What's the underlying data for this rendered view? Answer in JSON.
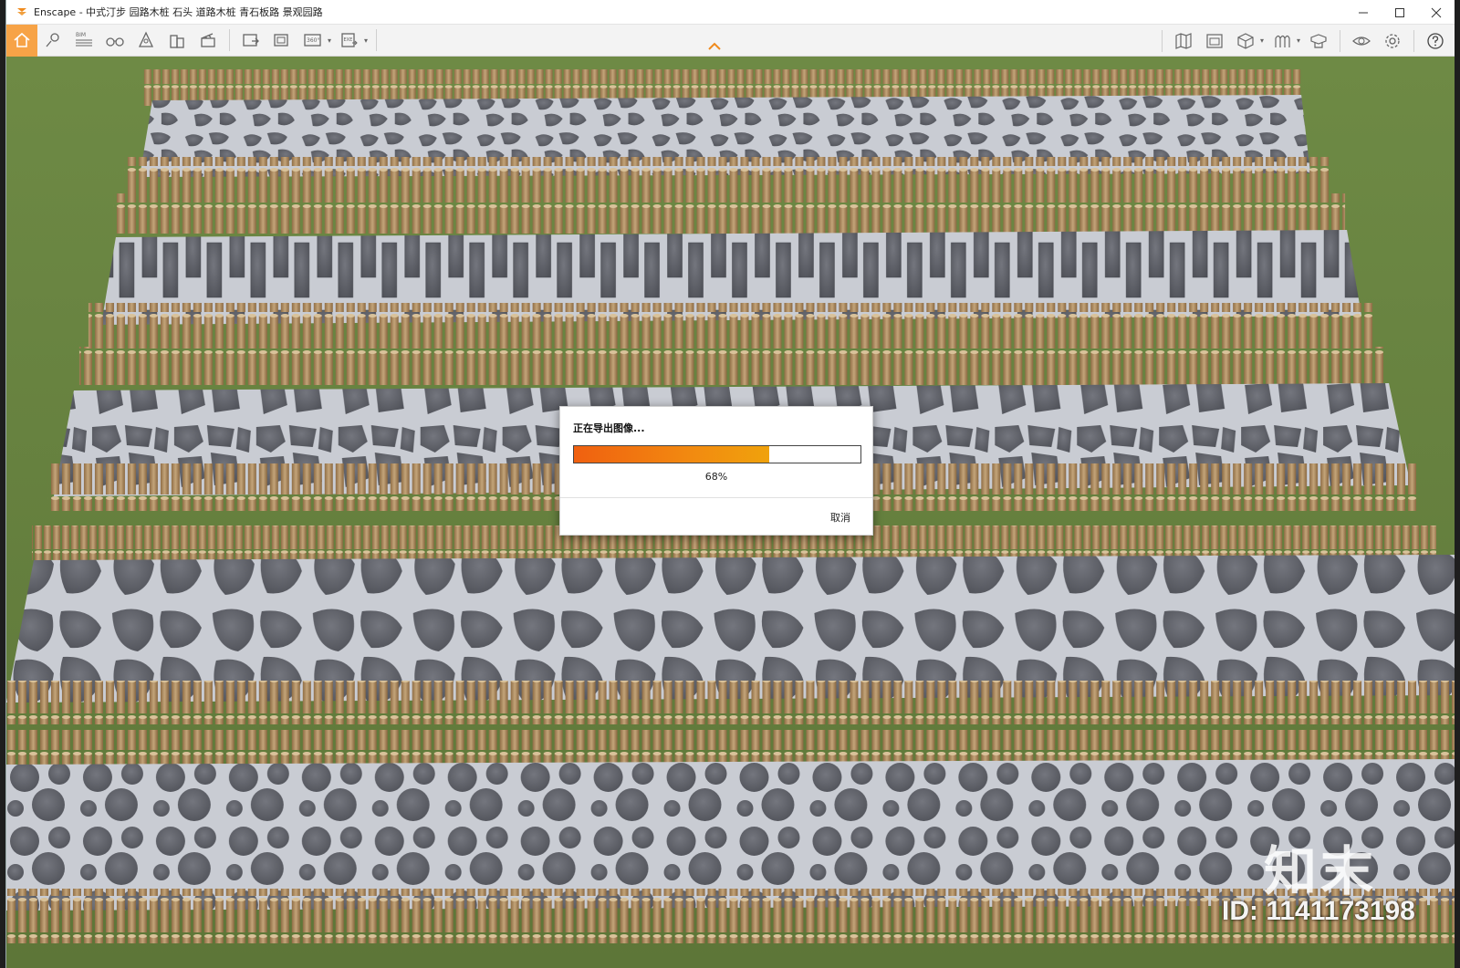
{
  "window": {
    "app_name": "Enscape",
    "title": "Enscape - 中式汀步 园路木桩 石头 道路木桩 青石板路 景观园路"
  },
  "toolbar": {
    "left_buttons": [
      {
        "icon": "home-icon",
        "active": true
      },
      {
        "icon": "map-pin-icon"
      },
      {
        "icon": "bim-icon",
        "label": "BIM"
      },
      {
        "icon": "binoculars-icon"
      },
      {
        "icon": "perspective-icon"
      },
      {
        "icon": "buildings-icon"
      },
      {
        "icon": "clapperboard-icon"
      },
      {
        "icon": "screenshot-icon"
      },
      {
        "icon": "batch-render-icon"
      },
      {
        "icon": "panorama-360-icon",
        "label": "360°",
        "dropdown": true
      },
      {
        "icon": "export-exe-icon",
        "label": "EXE",
        "dropdown": true
      }
    ],
    "right_buttons": [
      {
        "icon": "map-icon"
      },
      {
        "icon": "views-icon"
      },
      {
        "icon": "cube-icon",
        "dropdown": true
      },
      {
        "icon": "materials-icon",
        "dropdown": true
      },
      {
        "icon": "asset-library-icon"
      },
      {
        "icon": "eye-icon"
      },
      {
        "icon": "settings-icon"
      },
      {
        "icon": "help-icon"
      }
    ]
  },
  "dialog": {
    "title": "正在导出图像...",
    "progress": 0.68,
    "progress_text": "68%",
    "cancel_label": "取消"
  },
  "watermark": {
    "logo": "知末",
    "id_text": "ID: 1141173198"
  },
  "colors": {
    "accent": "#f7a347",
    "progress_start": "#f06010",
    "progress_end": "#f0a20c",
    "grass": "#6b7f44",
    "path": "#c9cdd4",
    "stone": "#5e6068",
    "log": "#b5966a"
  }
}
